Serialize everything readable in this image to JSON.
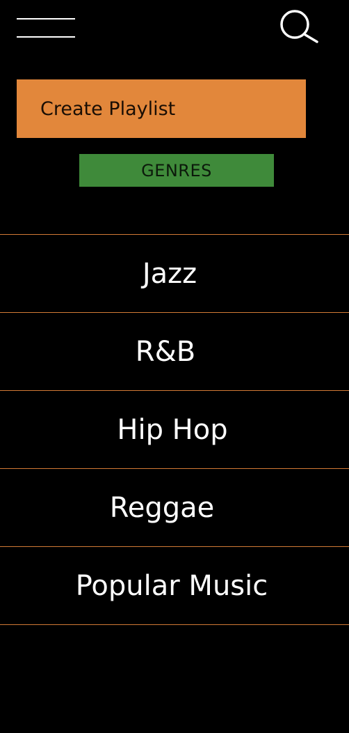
{
  "header": {
    "menu_icon": "hamburger-menu-icon",
    "search_icon": "search-icon"
  },
  "actions": {
    "create_playlist_label": "Create Playlist"
  },
  "section": {
    "title": "GENRES"
  },
  "genres": [
    {
      "label": "Jazz"
    },
    {
      "label": "R&B"
    },
    {
      "label": "Hip Hop"
    },
    {
      "label": "Reggae"
    },
    {
      "label": "Popular Music"
    }
  ],
  "colors": {
    "background": "#000000",
    "create_playlist_bg": "#e2873b",
    "genres_badge_bg": "#3f8a3a",
    "divider": "#d27a35",
    "text_light": "#ffffff"
  }
}
